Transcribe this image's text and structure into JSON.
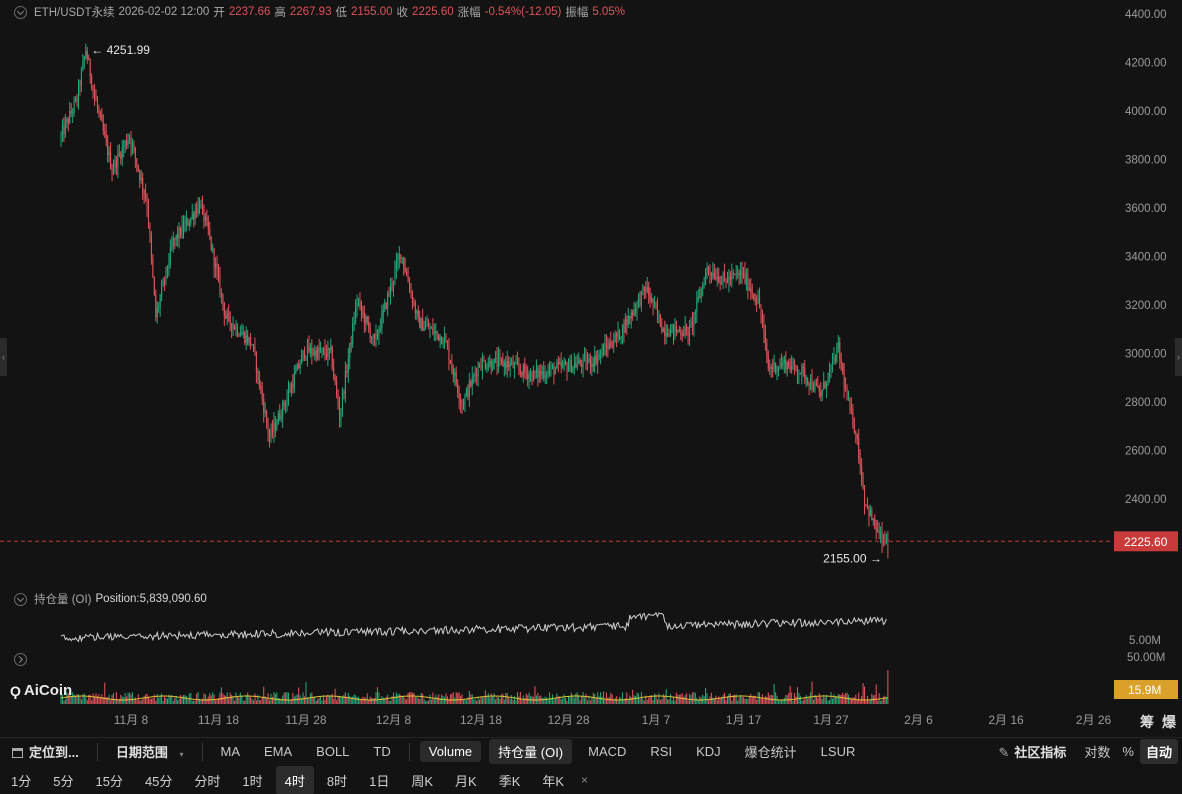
{
  "header": {
    "symbol": "ETH/USDT永续",
    "datetime": "2026-02-02 12:00",
    "open_label": "开",
    "open": "2237.66",
    "high_label": "高",
    "high": "2267.93",
    "low_label": "低",
    "low": "2155.00",
    "close_label": "收",
    "close": "2225.60",
    "change_label": "涨幅",
    "change": "-0.54%(-12.05)",
    "amplitude_label": "振幅",
    "amplitude": "5.05%"
  },
  "markers": {
    "high_marker": "4251.99",
    "low_marker": "2155.00",
    "current_price_tag": "2225.60"
  },
  "oi": {
    "label": "持仓量 (OI)",
    "position_label": "Position:",
    "position_value": "5,839,090.60",
    "axis_label": "5.00M"
  },
  "volume": {
    "axis_top": "50.00M",
    "current_tag": "15.9M"
  },
  "brand": {
    "name": "AiCoin"
  },
  "side_labels": [
    "筹",
    "爆"
  ],
  "colors": {
    "up": "#22a57a",
    "down": "#e0535a",
    "accent_tag": "#c93b3b",
    "volume_tag": "#d9a02a",
    "oi_line": "#d0d0d0",
    "ma_yellow": "#e6c434"
  },
  "toolbar": {
    "locate": "定位到...",
    "date_range": "日期范围",
    "indicators": [
      "MA",
      "EMA",
      "BOLL",
      "TD"
    ],
    "sub_indicators": [
      "Volume",
      "持仓量 (OI)",
      "MACD",
      "RSI",
      "KDJ",
      "爆仓统计",
      "LSUR"
    ],
    "active_sub_indicators": [
      "Volume",
      "持仓量 (OI)"
    ],
    "community": "社区指标",
    "log": "对数",
    "percent": "%",
    "auto": "自动"
  },
  "timeframes": {
    "items": [
      "1分",
      "5分",
      "15分",
      "45分",
      "分时",
      "1时",
      "4时",
      "8时",
      "1日",
      "周K",
      "月K",
      "季K",
      "年K"
    ],
    "active": "4时",
    "close": "×"
  },
  "chart_data": {
    "type": "candlestick",
    "title": "",
    "interval": "4H",
    "x_tick_labels": [
      "11月 8",
      "11月 18",
      "11月 28",
      "12月 8",
      "12月 18",
      "12月 28",
      "1月 7",
      "1月 17",
      "1月 27",
      "2月 6",
      "2月 16",
      "2月 26"
    ],
    "y_tick_labels": [
      "4400.00",
      "4200.00",
      "4000.00",
      "3800.00",
      "3600.00",
      "3400.00",
      "3200.00",
      "3000.00",
      "2800.00",
      "2600.00",
      "2400.00"
    ],
    "ylim": [
      2080,
      4400
    ],
    "grid": false,
    "price_path_anchors": [
      {
        "x": "2025-10-31",
        "y": 3880
      },
      {
        "x": "2025-11-02",
        "y": 4050
      },
      {
        "x": "2025-11-03",
        "y": 4251.99
      },
      {
        "x": "2025-11-04",
        "y": 4060
      },
      {
        "x": "2025-11-06",
        "y": 3760
      },
      {
        "x": "2025-11-08",
        "y": 3900
      },
      {
        "x": "2025-11-10",
        "y": 3620
      },
      {
        "x": "2025-11-11",
        "y": 3150
      },
      {
        "x": "2025-11-13",
        "y": 3460
      },
      {
        "x": "2025-11-15",
        "y": 3560
      },
      {
        "x": "2025-11-16",
        "y": 3620
      },
      {
        "x": "2025-11-17",
        "y": 3500
      },
      {
        "x": "2025-11-19",
        "y": 3150
      },
      {
        "x": "2025-11-22",
        "y": 3040
      },
      {
        "x": "2025-11-24",
        "y": 2650
      },
      {
        "x": "2025-11-26",
        "y": 2820
      },
      {
        "x": "2025-11-28",
        "y": 3010
      },
      {
        "x": "2025-12-01",
        "y": 3000
      },
      {
        "x": "2025-12-02",
        "y": 2740
      },
      {
        "x": "2025-12-04",
        "y": 3220
      },
      {
        "x": "2025-12-06",
        "y": 3040
      },
      {
        "x": "2025-12-09",
        "y": 3420
      },
      {
        "x": "2025-12-11",
        "y": 3130
      },
      {
        "x": "2025-12-14",
        "y": 3060
      },
      {
        "x": "2025-12-16",
        "y": 2790
      },
      {
        "x": "2025-12-18",
        "y": 2960
      },
      {
        "x": "2025-12-21",
        "y": 2960
      },
      {
        "x": "2025-12-24",
        "y": 2910
      },
      {
        "x": "2025-12-27",
        "y": 2940
      },
      {
        "x": "2025-12-31",
        "y": 2970
      },
      {
        "x": "2026-01-03",
        "y": 3080
      },
      {
        "x": "2026-01-06",
        "y": 3270
      },
      {
        "x": "2026-01-08",
        "y": 3100
      },
      {
        "x": "2026-01-11",
        "y": 3090
      },
      {
        "x": "2026-01-13",
        "y": 3350
      },
      {
        "x": "2026-01-15",
        "y": 3300
      },
      {
        "x": "2026-01-17",
        "y": 3330
      },
      {
        "x": "2026-01-19",
        "y": 3200
      },
      {
        "x": "2026-01-20",
        "y": 2940
      },
      {
        "x": "2026-01-22",
        "y": 2960
      },
      {
        "x": "2026-01-24",
        "y": 2920
      },
      {
        "x": "2026-01-26",
        "y": 2830
      },
      {
        "x": "2026-01-28",
        "y": 3020
      },
      {
        "x": "2026-01-29",
        "y": 2810
      },
      {
        "x": "2026-01-30",
        "y": 2680
      },
      {
        "x": "2026-01-31",
        "y": 2400
      },
      {
        "x": "2026-02-01",
        "y": 2300
      },
      {
        "x": "2026-02-02",
        "y": 2225.6
      }
    ],
    "last_candle": {
      "x": "2026-02-02 12:00",
      "open": 2237.66,
      "high": 2267.93,
      "low": 2155.0,
      "close": 2225.6
    },
    "period_high": 4251.99,
    "period_low": 2155.0,
    "open_interest_current": 5839090.6,
    "volume_current": "15.9M"
  }
}
